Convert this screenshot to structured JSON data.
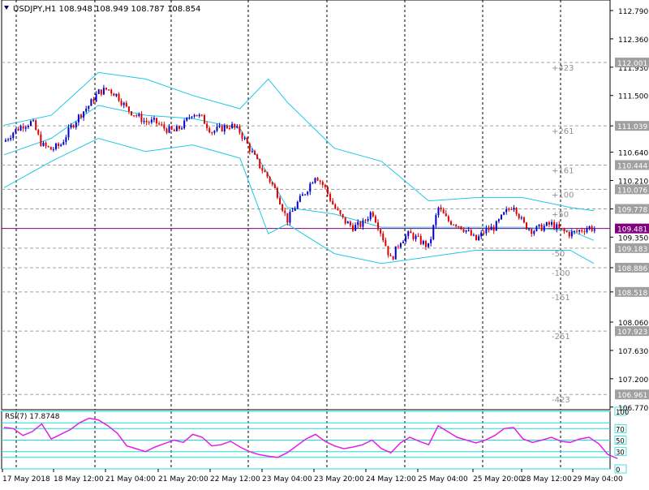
{
  "colors": {
    "background": "#ffffff",
    "grid": "#000000",
    "level_line": "#a0a0a0",
    "bull": "#0000cc",
    "bear": "#dd0000",
    "bands": "#1ec8e6",
    "rsi": "#e21ee6",
    "rsi_levels": "#20d8d8",
    "bid_line": "#800080",
    "label_gray": "#909090",
    "text": "#000000"
  },
  "chart": {
    "header": "USDJPY,H1  108.948 108.949 108.787 108.854",
    "collapse_icon": "triangle-down-icon"
  },
  "chart_data": [
    {
      "type": "candlestick",
      "symbol": "USDJPY",
      "timeframe": "H1",
      "ohlc_current": {
        "open": 108.948,
        "high": 108.949,
        "low": 108.787,
        "close": 108.854
      },
      "ylim": [
        106.73,
        112.95
      ],
      "y_ticks": [
        "112.790",
        "112.360",
        "111.930",
        "111.500",
        "111.039",
        "110.640",
        "110.210",
        "109.778",
        "109.350",
        "108.886",
        "108.518",
        "108.060",
        "107.630",
        "107.200",
        "106.770"
      ],
      "x_tick_labels": [
        "17 May 2018",
        "18 May 12:00",
        "21 May 04:00",
        "21 May 20:00",
        "22 May 12:00",
        "23 May 04:00",
        "23 May 20:00",
        "24 May 12:00",
        "25 May 04:00",
        "25 May 20:00",
        "28 May 12:00",
        "29 May 04:00"
      ],
      "level_lines": [
        {
          "price": 112.001,
          "label": "+423",
          "price_label": "112.001"
        },
        {
          "price": 111.039,
          "label": "+261",
          "price_label": "111.039"
        },
        {
          "price": 110.444,
          "label": "+161",
          "price_label": "110.444"
        },
        {
          "price": 110.076,
          "label": "+100",
          "price_label": "110.076"
        },
        {
          "price": 109.778,
          "label": "+50",
          "price_label": "109.778"
        },
        {
          "price": 109.183,
          "label": "-50",
          "price_label": "109.183"
        },
        {
          "price": 108.886,
          "label": "-100",
          "price_label": "108.886"
        },
        {
          "price": 108.518,
          "label": "-161",
          "price_label": "108.518"
        },
        {
          "price": 107.923,
          "label": "-261",
          "price_label": "107.923"
        },
        {
          "price": 106.961,
          "label": "-423",
          "price_label": "106.961"
        }
      ],
      "bid_line": {
        "price": 109.481,
        "label": "109.481"
      },
      "close_series": [
        [
          0,
          110.8
        ],
        [
          6,
          110.95
        ],
        [
          12,
          111.05
        ],
        [
          18,
          111.1
        ],
        [
          24,
          110.75
        ],
        [
          30,
          110.68
        ],
        [
          36,
          110.75
        ],
        [
          42,
          111.0
        ],
        [
          48,
          111.2
        ],
        [
          54,
          111.35
        ],
        [
          60,
          111.55
        ],
        [
          66,
          111.6
        ],
        [
          72,
          111.5
        ],
        [
          78,
          111.3
        ],
        [
          84,
          111.2
        ],
        [
          90,
          111.1
        ],
        [
          96,
          111.1
        ],
        [
          102,
          111.0
        ],
        [
          108,
          110.95
        ],
        [
          114,
          111.05
        ],
        [
          120,
          111.25
        ],
        [
          126,
          111.15
        ],
        [
          132,
          110.95
        ],
        [
          138,
          111.0
        ],
        [
          144,
          111.05
        ],
        [
          150,
          110.95
        ],
        [
          156,
          110.7
        ],
        [
          162,
          110.45
        ],
        [
          168,
          110.25
        ],
        [
          174,
          110.0
        ],
        [
          180,
          109.6
        ],
        [
          186,
          109.85
        ],
        [
          192,
          110.05
        ],
        [
          198,
          110.3
        ],
        [
          204,
          110.1
        ],
        [
          210,
          109.8
        ],
        [
          216,
          109.6
        ],
        [
          222,
          109.5
        ],
        [
          228,
          109.55
        ],
        [
          234,
          109.75
        ],
        [
          240,
          109.4
        ],
        [
          246,
          109.0
        ],
        [
          252,
          109.3
        ],
        [
          258,
          109.4
        ],
        [
          264,
          109.3
        ],
        [
          270,
          109.2
        ],
        [
          276,
          109.8
        ],
        [
          282,
          109.6
        ],
        [
          288,
          109.55
        ],
        [
          294,
          109.45
        ],
        [
          300,
          109.3
        ],
        [
          306,
          109.45
        ],
        [
          312,
          109.5
        ],
        [
          318,
          109.7
        ],
        [
          324,
          109.85
        ],
        [
          330,
          109.55
        ],
        [
          336,
          109.45
        ],
        [
          342,
          109.5
        ],
        [
          348,
          109.55
        ],
        [
          354,
          109.45
        ],
        [
          360,
          109.4
        ],
        [
          366,
          109.45
        ],
        [
          372,
          109.5
        ],
        [
          378,
          109.45
        ],
        [
          384,
          109.0
        ],
        [
          390,
          108.85
        ]
      ],
      "bands": {
        "upper": [
          [
            0,
            111.05
          ],
          [
            30,
            111.2
          ],
          [
            60,
            111.85
          ],
          [
            90,
            111.75
          ],
          [
            120,
            111.5
          ],
          [
            150,
            111.3
          ],
          [
            168,
            111.75
          ],
          [
            180,
            111.4
          ],
          [
            210,
            110.7
          ],
          [
            240,
            110.5
          ],
          [
            270,
            109.9
          ],
          [
            300,
            109.95
          ],
          [
            330,
            109.95
          ],
          [
            360,
            109.8
          ],
          [
            375,
            109.75
          ]
        ],
        "middle": [
          [
            0,
            110.6
          ],
          [
            30,
            110.85
          ],
          [
            60,
            111.35
          ],
          [
            90,
            111.2
          ],
          [
            120,
            111.15
          ],
          [
            150,
            111.0
          ],
          [
            168,
            110.3
          ],
          [
            180,
            109.8
          ],
          [
            210,
            109.7
          ],
          [
            240,
            109.5
          ],
          [
            270,
            109.5
          ],
          [
            300,
            109.5
          ],
          [
            330,
            109.5
          ],
          [
            360,
            109.45
          ],
          [
            375,
            109.3
          ]
        ],
        "lower": [
          [
            0,
            110.1
          ],
          [
            30,
            110.5
          ],
          [
            60,
            110.85
          ],
          [
            90,
            110.65
          ],
          [
            120,
            110.75
          ],
          [
            150,
            110.55
          ],
          [
            168,
            109.4
          ],
          [
            180,
            109.55
          ],
          [
            210,
            109.1
          ],
          [
            240,
            108.95
          ],
          [
            270,
            109.05
          ],
          [
            300,
            109.15
          ],
          [
            330,
            109.15
          ],
          [
            360,
            109.15
          ],
          [
            375,
            108.95
          ]
        ]
      }
    },
    {
      "type": "line",
      "name": "RSI(7) 17.8748",
      "ylim": [
        0,
        100
      ],
      "levels": [
        0,
        20,
        30,
        50,
        70,
        80,
        100
      ],
      "level_labels": [
        "100",
        "70",
        "50",
        "30",
        "0"
      ],
      "series": [
        [
          0,
          72
        ],
        [
          6,
          70
        ],
        [
          12,
          58
        ],
        [
          18,
          65
        ],
        [
          24,
          78
        ],
        [
          30,
          52
        ],
        [
          36,
          60
        ],
        [
          42,
          68
        ],
        [
          48,
          80
        ],
        [
          54,
          88
        ],
        [
          60,
          85
        ],
        [
          66,
          75
        ],
        [
          72,
          62
        ],
        [
          78,
          40
        ],
        [
          84,
          35
        ],
        [
          90,
          30
        ],
        [
          96,
          38
        ],
        [
          102,
          44
        ],
        [
          108,
          50
        ],
        [
          114,
          46
        ],
        [
          120,
          60
        ],
        [
          126,
          55
        ],
        [
          132,
          40
        ],
        [
          138,
          42
        ],
        [
          144,
          48
        ],
        [
          150,
          38
        ],
        [
          156,
          30
        ],
        [
          162,
          25
        ],
        [
          168,
          22
        ],
        [
          174,
          20
        ],
        [
          180,
          28
        ],
        [
          186,
          40
        ],
        [
          192,
          52
        ],
        [
          198,
          60
        ],
        [
          204,
          48
        ],
        [
          210,
          40
        ],
        [
          216,
          35
        ],
        [
          222,
          38
        ],
        [
          228,
          42
        ],
        [
          234,
          50
        ],
        [
          240,
          35
        ],
        [
          246,
          28
        ],
        [
          252,
          45
        ],
        [
          258,
          55
        ],
        [
          264,
          48
        ],
        [
          270,
          42
        ],
        [
          276,
          75
        ],
        [
          282,
          65
        ],
        [
          288,
          55
        ],
        [
          294,
          50
        ],
        [
          300,
          45
        ],
        [
          306,
          50
        ],
        [
          312,
          58
        ],
        [
          318,
          70
        ],
        [
          324,
          72
        ],
        [
          330,
          52
        ],
        [
          336,
          46
        ],
        [
          342,
          50
        ],
        [
          348,
          55
        ],
        [
          354,
          48
        ],
        [
          360,
          46
        ],
        [
          366,
          52
        ],
        [
          372,
          55
        ],
        [
          378,
          44
        ],
        [
          384,
          25
        ],
        [
          390,
          18
        ]
      ]
    }
  ]
}
